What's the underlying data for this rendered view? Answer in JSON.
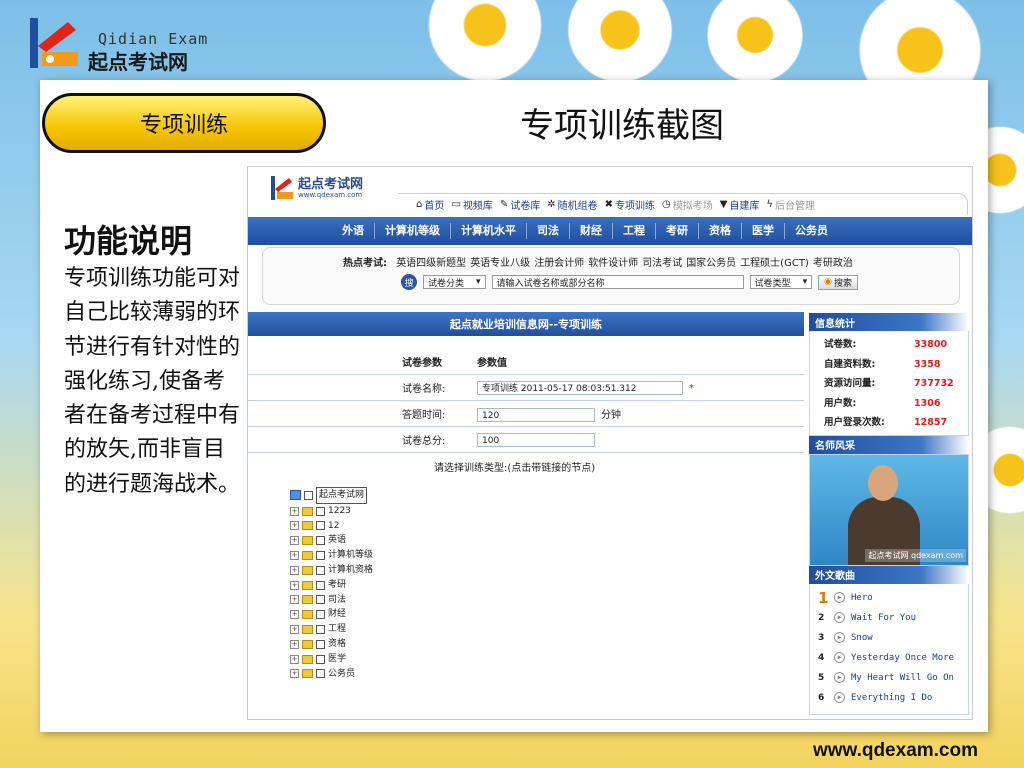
{
  "brand": {
    "en": "Qidian Exam",
    "cn": "起点考试网"
  },
  "header": {
    "section_label": "专项训练",
    "title": "专项训练截图"
  },
  "description": {
    "heading": "功能说明",
    "body": "专项训练功能可对自己比较薄弱的环节进行有针对性的强化练习,使备考者在备考过程中有的放矢,而非盲目的进行题海战术。"
  },
  "screenshot": {
    "logo_title": "起点考试网",
    "logo_sub": "www.qdexam.com",
    "top_nav": [
      {
        "icon": "home-icon",
        "glyph": "⌂",
        "label": "首页",
        "dim": false
      },
      {
        "icon": "monitor-icon",
        "glyph": "▭",
        "label": "视频库",
        "dim": false
      },
      {
        "icon": "pencil-icon",
        "glyph": "✎",
        "label": "试卷库",
        "dim": false
      },
      {
        "icon": "gear-icon",
        "glyph": "✲",
        "label": "随机组卷",
        "dim": false
      },
      {
        "icon": "tools-icon",
        "glyph": "✖",
        "label": "专项训练",
        "dim": false
      },
      {
        "icon": "clock-icon",
        "glyph": "◷",
        "label": "模拟考场",
        "dim": true
      },
      {
        "icon": "shirt-icon",
        "glyph": "▼",
        "label": "自建库",
        "dim": false
      },
      {
        "icon": "lightning-icon",
        "glyph": "ϟ",
        "label": "后台管理",
        "dim": true
      }
    ],
    "menu": [
      "外语",
      "计算机等级",
      "计算机水平",
      "司法",
      "财经",
      "工程",
      "考研",
      "资格",
      "医学",
      "公务员"
    ],
    "hot": {
      "label": "热点考试:",
      "items": [
        "英语四级新题型",
        "英语专业八级",
        "注册会计师",
        "软件设计师",
        "司法考试",
        "国家公务员",
        "工程硕士(GCT)",
        "考研政治"
      ]
    },
    "search": {
      "icon_label": "搜",
      "category": "试卷分类",
      "placeholder": "请输入试卷名称或部分名称",
      "type": "试卷类型",
      "button": "搜索"
    },
    "main_title": "起点就业培训信息网--专项训练",
    "params": {
      "col1": "试卷参数",
      "col2": "参数值",
      "rows": [
        {
          "label": "试卷名称:",
          "value": "专项训练  2011-05-17 08:03:51.312",
          "required": "*",
          "unit": ""
        },
        {
          "label": "答题时间:",
          "value": "120",
          "required": "",
          "unit": "分钟"
        },
        {
          "label": "试卷总分:",
          "value": "100",
          "required": "",
          "unit": ""
        }
      ]
    },
    "choose_prompt": "请选择训练类型:(点击带链接的节点)",
    "tree": {
      "root": "起点考试网",
      "nodes": [
        "1223",
        "12",
        "英语",
        "计算机等级",
        "计算机资格",
        "考研",
        "司法",
        "财经",
        "工程",
        "资格",
        "医学",
        "公务员"
      ]
    },
    "stats": {
      "title": "信息统计",
      "rows": [
        {
          "label": "试卷数:",
          "value": "33800"
        },
        {
          "label": "自建资料数:",
          "value": "3358"
        },
        {
          "label": "资源访问量:",
          "value": "737732"
        },
        {
          "label": "用户数:",
          "value": "1306"
        },
        {
          "label": "用户登录次数:",
          "value": "12857"
        }
      ]
    },
    "teacher": {
      "title": "名师风采",
      "tag": "起点考试网 qdexam.com"
    },
    "songs": {
      "title": "外文歌曲",
      "items": [
        {
          "num": "1",
          "name": "Hero"
        },
        {
          "num": "2",
          "name": "Wait For You"
        },
        {
          "num": "3",
          "name": "Snow"
        },
        {
          "num": "4",
          "name": "Yesterday Once More"
        },
        {
          "num": "5",
          "name": "My Heart Will Go On"
        },
        {
          "num": "6",
          "name": "Everything I Do"
        }
      ]
    }
  },
  "footer": {
    "url": "www.qdexam.com"
  },
  "colors": {
    "accent_blue": "#1f4f9d",
    "stat_red": "#e21b1b",
    "pill_yellow": "#f5c400"
  }
}
